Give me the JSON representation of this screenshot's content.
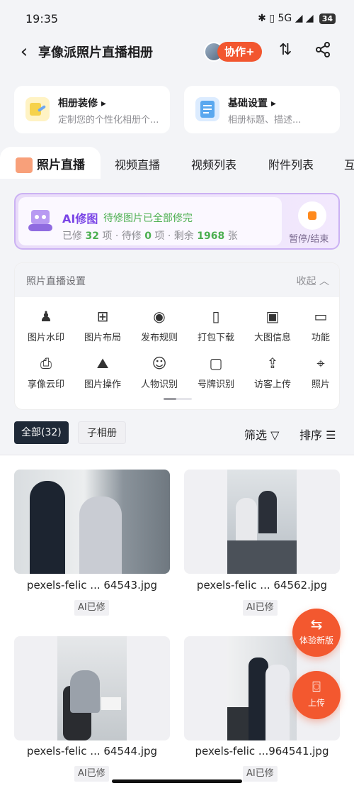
{
  "status": {
    "time": "19:35",
    "icons": "✱ ▯ 5G ◢ ◢",
    "battery": "34"
  },
  "header": {
    "back_icon": "‹",
    "title": "享像派照片直播相册",
    "collab_label": "协作+",
    "sort_icon": "⇅",
    "share_icon": "⋖"
  },
  "cards": [
    {
      "title": "相册装修",
      "desc": "定制您的个性化相册个...",
      "icon": "palette-icon",
      "color": "#f6d24a"
    },
    {
      "title": "基础设置",
      "desc": "相册标题、描述...",
      "icon": "settings-doc-icon",
      "color": "#5aa8ef"
    }
  ],
  "tabs": [
    "照片直播",
    "视频直播",
    "视频列表",
    "附件列表",
    "互"
  ],
  "ai": {
    "title": "AI修图",
    "status": "待修图片已全部修完",
    "done_label": "已修",
    "done": "32",
    "pending_label": "待修",
    "pending": "0",
    "remain_label": "剩余",
    "remain": "1968",
    "unit": "项",
    "unit2": "张",
    "stop_label": "暂停/结束"
  },
  "settings": {
    "title": "照片直播设置",
    "collapse": "收起",
    "tools": [
      {
        "label": "图片水印",
        "icon": "person-icon",
        "glyph": "♟"
      },
      {
        "label": "图片布局",
        "icon": "grid-icon",
        "glyph": "⊞"
      },
      {
        "label": "发布规则",
        "icon": "eye-icon",
        "glyph": "◉"
      },
      {
        "label": "打包下载",
        "icon": "zip-icon",
        "glyph": "▯"
      },
      {
        "label": "大图信息",
        "icon": "image-info-icon",
        "glyph": "▣"
      },
      {
        "label": "功能",
        "icon": "more-icon",
        "glyph": "▭"
      },
      {
        "label": "享像云印",
        "icon": "print-icon",
        "glyph": "⎙"
      },
      {
        "label": "图片操作",
        "icon": "image-icon",
        "glyph": "⛰"
      },
      {
        "label": "人物识别",
        "icon": "face-scan-icon",
        "glyph": "☺"
      },
      {
        "label": "号牌识别",
        "icon": "plate-scan-icon",
        "glyph": "▢"
      },
      {
        "label": "访客上传",
        "icon": "upload-icon",
        "glyph": "⇪"
      },
      {
        "label": "照片",
        "icon": "photo-icon",
        "glyph": "⌖"
      }
    ]
  },
  "filter": {
    "all_label": "全部(32)",
    "sub_label": "子相册",
    "filter_label": "筛选",
    "sort_label": "排序"
  },
  "photos": [
    {
      "name": "pexels-felic ... 64543.jpg",
      "tag": "AI已修"
    },
    {
      "name": "pexels-felic ... 64562.jpg",
      "tag": "AI已修"
    },
    {
      "name": "pexels-felic ... 64544.jpg",
      "tag": "AI已修"
    },
    {
      "name": "pexels-felic ...964541.jpg",
      "tag": "AI已修"
    }
  ],
  "fabs": {
    "newver_label": "体验新版",
    "upload_label": "上传"
  }
}
